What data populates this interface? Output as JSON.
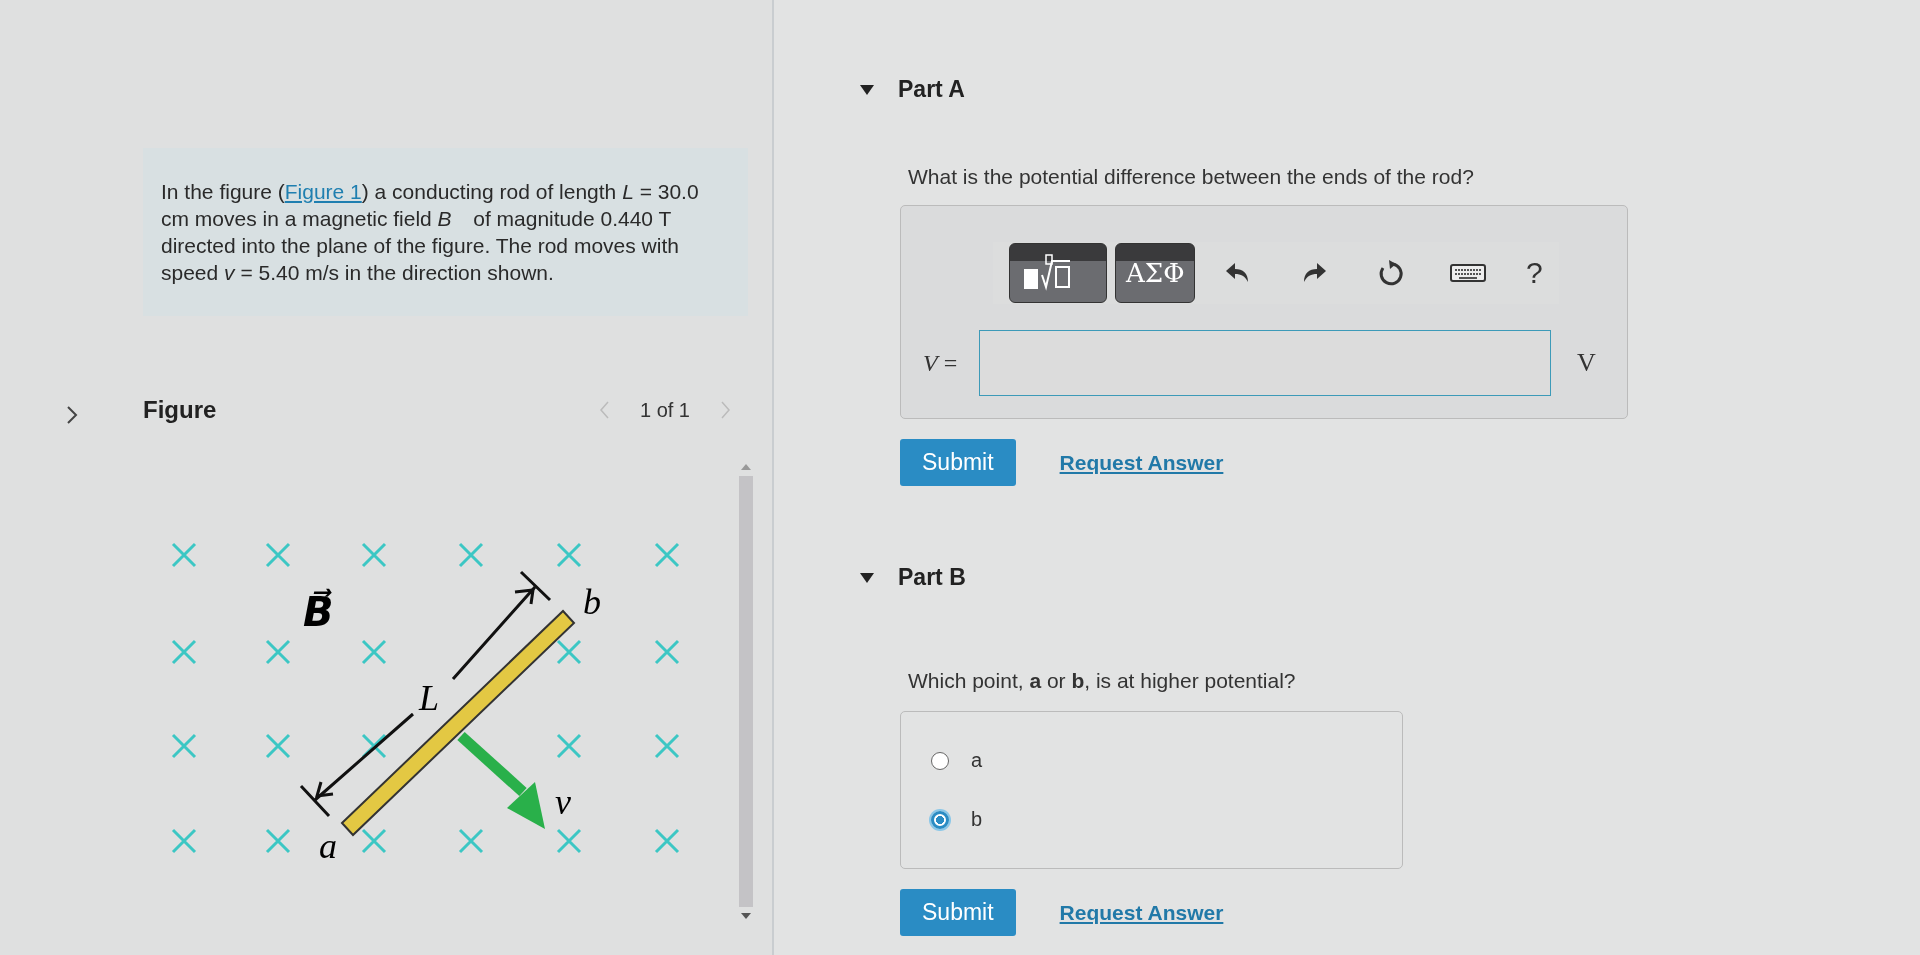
{
  "problem": {
    "before": "In the figure (",
    "link": "Figure 1",
    "after": ") a conducting rod of length *L* = 30.0 cm moves in a magnetic field *B⃗* of magnitude 0.440 T directed into the plane of the figure. The rod moves with speed *v* = 5.40 m/s in the direction shown."
  },
  "figure": {
    "title": "Figure",
    "pager": "1 of 1",
    "labels": {
      "field": "B⃗",
      "length": "L",
      "end_top": "b",
      "end_bottom": "a",
      "velocity": "v"
    }
  },
  "part_a": {
    "title": "Part A",
    "expanded": true,
    "question": "What is the potential difference between the ends of the rod?",
    "toolbar": {
      "symbols": "ΑΣΦ",
      "help": "?"
    },
    "answer": {
      "label": "*V* =",
      "unit": "V"
    },
    "submit": "Submit",
    "request": "Request Answer"
  },
  "part_b": {
    "title": "Part B",
    "expanded": true,
    "question": "Which point, **a** or **b**, is at higher potential?",
    "options": [
      {
        "label": "a",
        "selected": false
      },
      {
        "label": "b",
        "selected": true
      }
    ],
    "submit": "Submit",
    "request": "Request Answer"
  }
}
